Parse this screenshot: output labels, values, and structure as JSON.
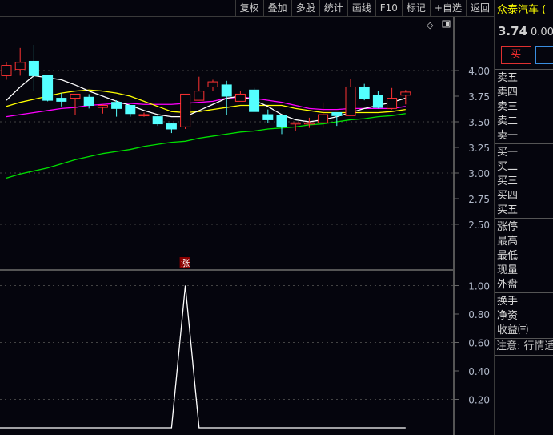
{
  "toolbar": {
    "items": [
      "复权",
      "叠加",
      "多股",
      "统计",
      "画线",
      "F10",
      "标记",
      "+自选",
      "返回"
    ]
  },
  "chart_icons": {
    "diamond": "diamond-icon",
    "panel_toggle": "panel-toggle-icon"
  },
  "quote": {
    "name": "众泰汽车 (",
    "price": "3.74",
    "change": "0.00",
    "buy_label": "买"
  },
  "orderbook": {
    "sell": [
      "卖五",
      "卖四",
      "卖三",
      "卖二",
      "卖一"
    ],
    "buy": [
      "买一",
      "买二",
      "买三",
      "买四",
      "买五"
    ],
    "stats1": [
      "涨停",
      "最高",
      "最低",
      "现量",
      "外盘"
    ],
    "stats2": [
      "换手",
      "净资",
      "收益㈢"
    ],
    "note": "注意: 行情适"
  },
  "colors": {
    "up": "#ff3232",
    "down": "#54ffff",
    "ma5": "#ffffff",
    "ma10": "#ffff00",
    "ma20": "#ff00ff",
    "ma60": "#00e000",
    "signal": "#ffffff",
    "marker_bg": "#8b0000"
  },
  "chart_data": [
    {
      "type": "candlestick",
      "yticks": [
        "4.00",
        "3.75",
        "3.50",
        "3.25",
        "3.00",
        "2.75",
        "2.50"
      ],
      "ylim": [
        2.4,
        4.3
      ],
      "candles": [
        {
          "o": 3.95,
          "c": 4.05,
          "h": 4.08,
          "l": 3.91
        },
        {
          "o": 4.01,
          "c": 4.08,
          "h": 4.22,
          "l": 3.95
        },
        {
          "o": 4.09,
          "c": 3.95,
          "h": 4.25,
          "l": 3.8
        },
        {
          "o": 3.95,
          "c": 3.71,
          "h": 3.95,
          "l": 3.7
        },
        {
          "o": 3.73,
          "c": 3.7,
          "h": 3.78,
          "l": 3.65
        },
        {
          "o": 3.73,
          "c": 3.77,
          "h": 3.77,
          "l": 3.57
        },
        {
          "o": 3.74,
          "c": 3.66,
          "h": 3.77,
          "l": 3.63
        },
        {
          "o": 3.64,
          "c": 3.66,
          "h": 3.67,
          "l": 3.58
        },
        {
          "o": 3.69,
          "c": 3.63,
          "h": 3.71,
          "l": 3.55
        },
        {
          "o": 3.66,
          "c": 3.58,
          "h": 3.66,
          "l": 3.55
        },
        {
          "o": 3.56,
          "c": 3.57,
          "h": 3.59,
          "l": 3.55
        },
        {
          "o": 3.55,
          "c": 3.48,
          "h": 3.56,
          "l": 3.46
        },
        {
          "o": 3.48,
          "c": 3.43,
          "h": 3.49,
          "l": 3.39
        },
        {
          "o": 3.45,
          "c": 3.77,
          "h": 3.77,
          "l": 3.43
        },
        {
          "o": 3.71,
          "c": 3.8,
          "h": 3.94,
          "l": 3.77
        },
        {
          "o": 3.84,
          "c": 3.89,
          "h": 3.91,
          "l": 3.8
        },
        {
          "o": 3.86,
          "c": 3.75,
          "h": 3.9,
          "l": 3.57
        },
        {
          "o": 3.7,
          "c": 3.77,
          "h": 3.8,
          "l": 3.7
        },
        {
          "o": 3.81,
          "c": 3.6,
          "h": 3.83,
          "l": 3.6
        },
        {
          "o": 3.57,
          "c": 3.52,
          "h": 3.62,
          "l": 3.49
        },
        {
          "o": 3.56,
          "c": 3.45,
          "h": 3.56,
          "l": 3.38
        },
        {
          "o": 3.49,
          "c": 3.49,
          "h": 3.49,
          "l": 3.41
        },
        {
          "o": 3.48,
          "c": 3.49,
          "h": 3.54,
          "l": 3.44
        },
        {
          "o": 3.49,
          "c": 3.57,
          "h": 3.69,
          "l": 3.44
        },
        {
          "o": 3.59,
          "c": 3.56,
          "h": 3.59,
          "l": 3.46
        },
        {
          "o": 3.56,
          "c": 3.84,
          "h": 3.92,
          "l": 3.56
        },
        {
          "o": 3.84,
          "c": 3.73,
          "h": 3.87,
          "l": 3.71
        },
        {
          "o": 3.76,
          "c": 3.64,
          "h": 3.8,
          "l": 3.63
        },
        {
          "o": 3.63,
          "c": 3.73,
          "h": 3.83,
          "l": 3.62
        },
        {
          "o": 3.76,
          "c": 3.79,
          "h": 3.81,
          "l": 3.67
        }
      ],
      "ma5": [
        3.71,
        3.84,
        3.95,
        3.93,
        3.91,
        3.86,
        3.8,
        3.75,
        3.7,
        3.66,
        3.61,
        3.57,
        3.55,
        3.55,
        3.61,
        3.67,
        3.73,
        3.75,
        3.71,
        3.65,
        3.57,
        3.52,
        3.5,
        3.52,
        3.55,
        3.59,
        3.63,
        3.66,
        3.69,
        3.73
      ],
      "ma10": [
        3.65,
        3.69,
        3.72,
        3.75,
        3.78,
        3.8,
        3.81,
        3.8,
        3.78,
        3.75,
        3.7,
        3.65,
        3.6,
        3.59,
        3.6,
        3.62,
        3.64,
        3.66,
        3.66,
        3.66,
        3.66,
        3.63,
        3.61,
        3.59,
        3.59,
        3.59,
        3.59,
        3.59,
        3.6,
        3.62
      ],
      "ma20": [
        3.55,
        3.57,
        3.59,
        3.61,
        3.63,
        3.64,
        3.66,
        3.67,
        3.68,
        3.68,
        3.67,
        3.67,
        3.67,
        3.68,
        3.69,
        3.7,
        3.73,
        3.74,
        3.73,
        3.71,
        3.69,
        3.66,
        3.63,
        3.62,
        3.62,
        3.63,
        3.63,
        3.63,
        3.63,
        3.65
      ],
      "ma60": [
        2.95,
        2.99,
        3.02,
        3.05,
        3.09,
        3.13,
        3.16,
        3.19,
        3.21,
        3.23,
        3.26,
        3.28,
        3.3,
        3.31,
        3.34,
        3.36,
        3.38,
        3.4,
        3.41,
        3.43,
        3.44,
        3.45,
        3.47,
        3.48,
        3.5,
        3.52,
        3.53,
        3.55,
        3.56,
        3.58
      ],
      "marker": {
        "index": 13,
        "label": "涨"
      }
    },
    {
      "type": "line",
      "yticks": [
        "1.00",
        "0.80",
        "0.60",
        "0.40",
        "0.20"
      ],
      "ylim": [
        0,
        1.1
      ],
      "values": [
        0,
        0,
        0,
        0,
        0,
        0,
        0,
        0,
        0,
        0,
        0,
        0,
        0,
        1,
        0,
        0,
        0,
        0,
        0,
        0,
        0,
        0,
        0,
        0,
        0,
        0,
        0,
        0,
        0,
        0
      ]
    }
  ]
}
